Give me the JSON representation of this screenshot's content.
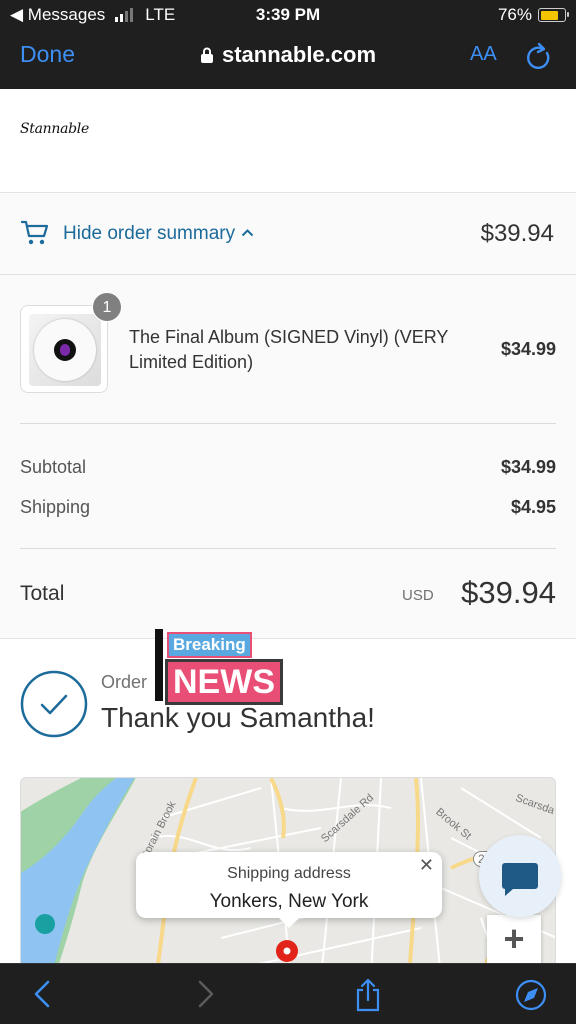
{
  "status_bar": {
    "back_app": "◀ Messages",
    "network": "LTE",
    "time": "3:39 PM",
    "battery": "76%",
    "battery_level": 0.76
  },
  "browser": {
    "done_label": "Done",
    "url": "stannable.com",
    "text_size_label": "AA"
  },
  "store": {
    "logo_text": "Stannable"
  },
  "order_summary": {
    "toggle_label": "Hide order summary",
    "header_total": "$39.94",
    "item": {
      "quantity": "1",
      "title": "The Final Album (SIGNED Vinyl) (VERY Limited Edition)",
      "price": "$34.99"
    },
    "subtotal_label": "Subtotal",
    "subtotal_value": "$34.99",
    "shipping_label": "Shipping",
    "shipping_value": "$4.95",
    "total_label": "Total",
    "currency": "USD",
    "total_value": "$39.94"
  },
  "confirmation": {
    "order_label": "Order",
    "thanks": "Thank you Samantha!"
  },
  "overlay": {
    "line1": "Breaking",
    "line2": "NEWS"
  },
  "map": {
    "street_labels": [
      "Sprain Brook",
      "Scarsdale Rd",
      "Brook St",
      "Scarsda",
      "22"
    ],
    "popup_title": "Shipping address",
    "popup_city": "Yonkers, New York",
    "zoom_in_label": "+"
  },
  "colors": {
    "link_blue": "#1c6b9b",
    "ios_blue": "#3d8ff5",
    "chrome_dark": "#1f1f1f",
    "map_pin": "#e2231a",
    "news_pink": "#e94e77",
    "news_blue": "#5aa8e0"
  }
}
